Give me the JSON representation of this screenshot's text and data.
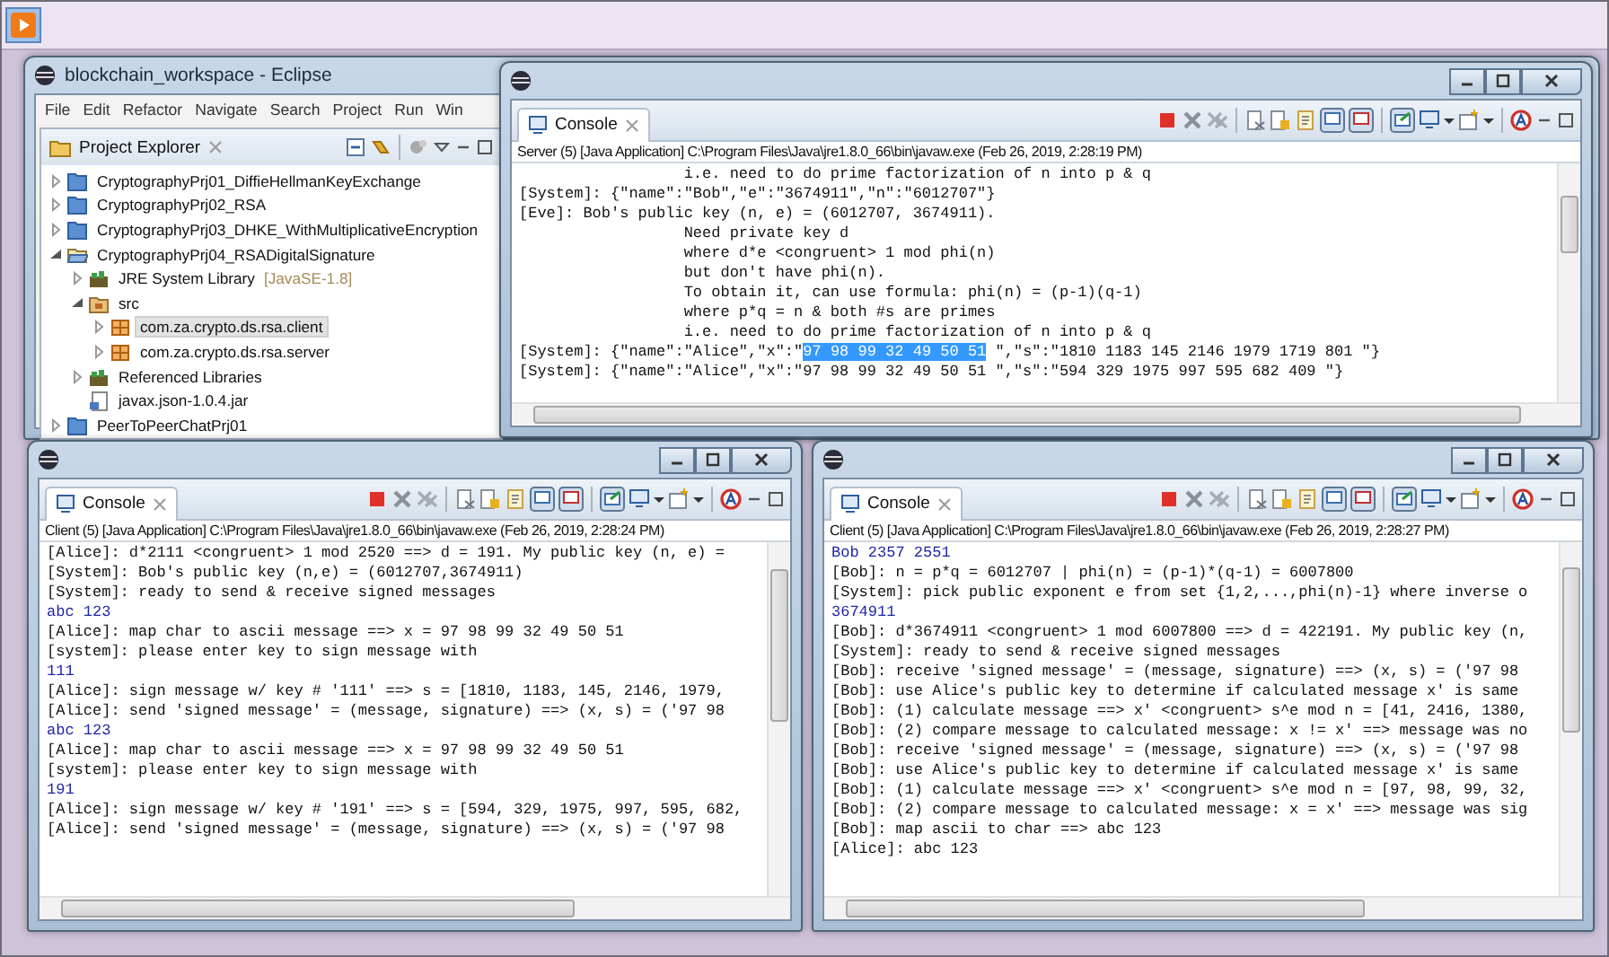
{
  "eclipse": {
    "title": "blockchain_workspace - Eclipse",
    "menu": [
      "File",
      "Edit",
      "Refactor",
      "Navigate",
      "Search",
      "Project",
      "Run",
      "Win"
    ],
    "explorer": {
      "title": "Project Explorer",
      "tree": [
        {
          "kind": "project",
          "label": "CryptographyPrj01_DiffieHellmanKeyExchange",
          "expanded": false,
          "selected": false
        },
        {
          "kind": "project",
          "label": "CryptographyPrj02_RSA",
          "expanded": false,
          "selected": false
        },
        {
          "kind": "project",
          "label": "CryptographyPrj03_DHKE_WithMultiplicativeEncryption",
          "expanded": false,
          "selected": false
        },
        {
          "kind": "project",
          "label": "CryptographyPrj04_RSADigitalSignature",
          "expanded": true,
          "selected": false,
          "children": [
            {
              "kind": "library",
              "label": "JRE System Library",
              "decoration": "[JavaSE-1.8]",
              "expanded": false,
              "selected": false
            },
            {
              "kind": "source-folder",
              "label": "src",
              "expanded": true,
              "selected": false,
              "children": [
                {
                  "kind": "package",
                  "label": "com.za.crypto.ds.rsa.client",
                  "expanded": false,
                  "selected": true
                },
                {
                  "kind": "package",
                  "label": "com.za.crypto.ds.rsa.server",
                  "expanded": false,
                  "selected": false
                }
              ]
            },
            {
              "kind": "library",
              "label": "Referenced Libraries",
              "expanded": false,
              "selected": false
            },
            {
              "kind": "jar",
              "label": "javax.json-1.0.4.jar",
              "selected": false
            }
          ]
        },
        {
          "kind": "project",
          "label": "PeerToPeerChatPrj01",
          "expanded": false,
          "selected": false
        }
      ]
    }
  },
  "consoles": [
    {
      "tab": "Console",
      "description": "Server (5) [Java Application] C:\\Program Files\\Java\\jre1.8.0_66\\bin\\javaw.exe (Feb 26, 2019, 2:28:19 PM)",
      "lines": [
        {
          "kind": "output",
          "text": "                  i.e. need to do prime factorization of n into p & q"
        },
        {
          "kind": "output",
          "text": "[System]: {\"name\":\"Bob\",\"e\":\"3674911\",\"n\":\"6012707\"}"
        },
        {
          "kind": "output",
          "text": "[Eve]: Bob's public key (n, e) = (6012707, 3674911)."
        },
        {
          "kind": "output",
          "text": "                  Need private key d"
        },
        {
          "kind": "output",
          "text": "                  where d*e <congruent> 1 mod phi(n)"
        },
        {
          "kind": "output",
          "text": "                  but don't have phi(n)."
        },
        {
          "kind": "output",
          "text": "                  To obtain it, can use formula: phi(n) = (p-1)(q-1)"
        },
        {
          "kind": "output",
          "text": "                  where p*q = n & both #s are primes"
        },
        {
          "kind": "output",
          "text": "                  i.e. need to do prime factorization of n into p & q"
        },
        {
          "kind": "selection",
          "before": "[System]: {\"name\":\"Alice\",\"x\":\"",
          "selected": "97 98 99 32 49 50 51",
          "after": " \",\"s\":\"1810 1183 145 2146 1979 1719 801 \"}"
        },
        {
          "kind": "output",
          "text": "[System]: {\"name\":\"Alice\",\"x\":\"97 98 99 32 49 50 51 \",\"s\":\"594 329 1975 997 595 682 409 \"}"
        }
      ]
    },
    {
      "tab": "Console",
      "description": "Client (5) [Java Application] C:\\Program Files\\Java\\jre1.8.0_66\\bin\\javaw.exe (Feb 26, 2019, 2:28:24 PM)",
      "lines": [
        {
          "kind": "output",
          "text": "[Alice]: d*2111 <congruent> 1 mod 2520 ==> d = 191. My public key (n, e) ="
        },
        {
          "kind": "output",
          "text": "[System]: Bob's public key (n,e) = (6012707,3674911)"
        },
        {
          "kind": "output",
          "text": "[System]: ready to send & receive signed messages"
        },
        {
          "kind": "input",
          "text": "abc 123"
        },
        {
          "kind": "output",
          "text": "[Alice]: map char to ascii message ==> x = 97 98 99 32 49 50 51"
        },
        {
          "kind": "output",
          "text": "[system]: please enter key to sign message with"
        },
        {
          "kind": "input",
          "text": "111"
        },
        {
          "kind": "output",
          "text": "[Alice]: sign message w/ key # '111' ==> s = [1810, 1183, 145, 2146, 1979,"
        },
        {
          "kind": "output",
          "text": "[Alice]: send 'signed message' = (message, signature) ==> (x, s) = ('97 98"
        },
        {
          "kind": "input",
          "text": "abc 123"
        },
        {
          "kind": "output",
          "text": "[Alice]: map char to ascii message ==> x = 97 98 99 32 49 50 51"
        },
        {
          "kind": "output",
          "text": "[system]: please enter key to sign message with"
        },
        {
          "kind": "input",
          "text": "191"
        },
        {
          "kind": "output",
          "text": "[Alice]: sign message w/ key # '191' ==> s = [594, 329, 1975, 997, 595, 682,"
        },
        {
          "kind": "output",
          "text": "[Alice]: send 'signed message' = (message, signature) ==> (x, s) = ('97 98"
        }
      ]
    },
    {
      "tab": "Console",
      "description": "Client (5) [Java Application] C:\\Program Files\\Java\\jre1.8.0_66\\bin\\javaw.exe (Feb 26, 2019, 2:28:27 PM)",
      "lines": [
        {
          "kind": "input",
          "text": "Bob 2357 2551"
        },
        {
          "kind": "output",
          "text": "[Bob]: n = p*q = 6012707 | phi(n) = (p-1)*(q-1) = 6007800"
        },
        {
          "kind": "output",
          "text": "[System]: pick public exponent e from set {1,2,...,phi(n)-1} where inverse o"
        },
        {
          "kind": "input",
          "text": "3674911"
        },
        {
          "kind": "output",
          "text": "[Bob]: d*3674911 <congruent> 1 mod 6007800 ==> d = 422191. My public key (n,"
        },
        {
          "kind": "output",
          "text": "[System]: ready to send & receive signed messages"
        },
        {
          "kind": "output",
          "text": "[Bob]: receive 'signed message' = (message, signature) ==> (x, s) = ('97 98"
        },
        {
          "kind": "output",
          "text": "[Bob]: use Alice's public key to determine if calculated message x' is same"
        },
        {
          "kind": "output",
          "text": "[Bob]: (1) calculate message ==> x' <congruent> s^e mod n = [41, 2416, 1380,"
        },
        {
          "kind": "output",
          "text": "[Bob]: (2) compare message to calculated message: x != x' ==> message was no"
        },
        {
          "kind": "output",
          "text": "[Bob]: receive 'signed message' = (message, signature) ==> (x, s) = ('97 98"
        },
        {
          "kind": "output",
          "text": "[Bob]: use Alice's public key to determine if calculated message x' is same"
        },
        {
          "kind": "output",
          "text": "[Bob]: (1) calculate message ==> x' <congruent> s^e mod n = [97, 98, 99, 32,"
        },
        {
          "kind": "output",
          "text": "[Bob]: (2) compare message to calculated message: x = x' ==> message was sig"
        },
        {
          "kind": "output",
          "text": "[Bob]: map ascii to char ==> abc 123"
        },
        {
          "kind": "output",
          "text": "[Alice]: abc 123"
        }
      ]
    }
  ]
}
